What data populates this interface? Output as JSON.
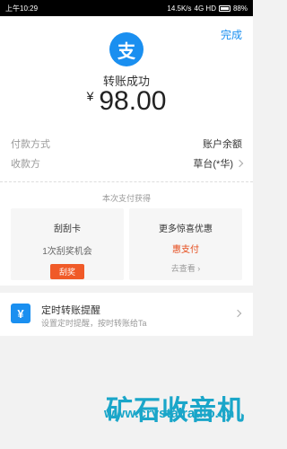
{
  "status": {
    "time": "上午10:29",
    "network": "14.5K/s",
    "signal": "4G HD",
    "battery": "88%"
  },
  "header": {
    "done": "完成",
    "logo_char": "支"
  },
  "result": {
    "title": "转账成功",
    "currency": "¥",
    "amount": "98.00"
  },
  "details": {
    "payment_label": "付款方式",
    "payment_value": "账户余额",
    "payee_label": "收款方",
    "payee_value": "草台(*华)"
  },
  "obtained_title": "本次支付获得",
  "cards": {
    "left": {
      "title": "刮刮卡",
      "subtitle": "1次刮奖机会",
      "button": "刮奖"
    },
    "right": {
      "title": "更多惊喜优惠",
      "highlight": "惠支付",
      "link": "去查看"
    }
  },
  "timer": {
    "icon": "¥",
    "title": "定时转账提醒",
    "subtitle": "设置定时提醒，按时转账给Ta"
  },
  "watermark": {
    "text": "矿石收音机",
    "url": "www.crystalradio.cn"
  }
}
